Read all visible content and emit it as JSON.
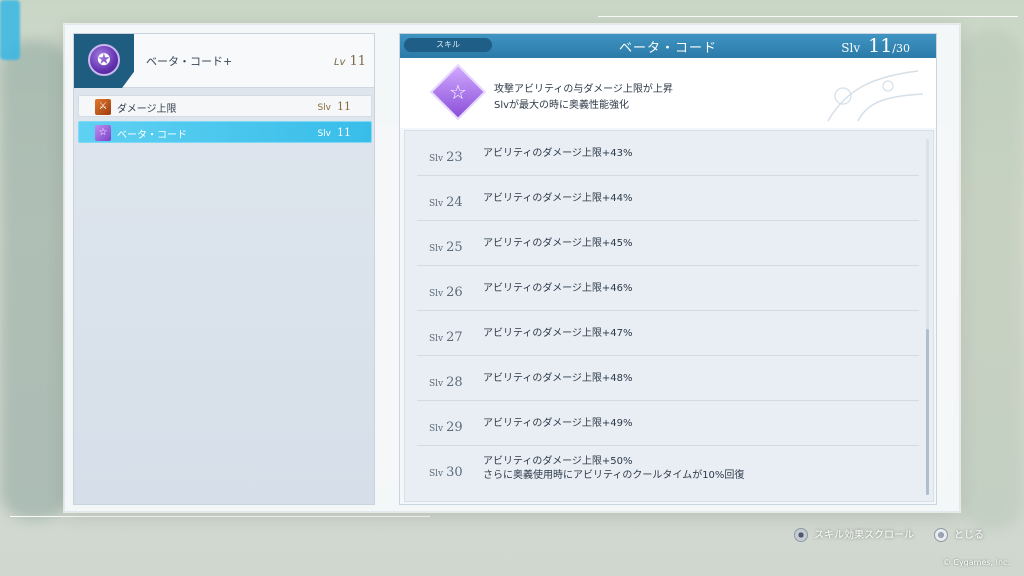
{
  "colors": {
    "accent_blue": "#38bde9",
    "header_blue": "#2b7aa8",
    "star_purple": "#8a4fd8",
    "sword_orange": "#e0782a"
  },
  "left_panel": {
    "emblem_icon": "purple-star-emblem-icon",
    "title": "ベータ・コード+",
    "lv_label": "Lv",
    "lv_value": "11",
    "skills": [
      {
        "icon": "sword-icon",
        "name": "ダメージ上限",
        "slv_label": "Slv",
        "slv_value": "11",
        "selected": false
      },
      {
        "icon": "star-icon",
        "name": "ベータ・コード",
        "slv_label": "Slv",
        "slv_value": "11",
        "selected": true
      }
    ]
  },
  "right_panel": {
    "tag": "スキル",
    "title": "ベータ・コード",
    "slv_label": "Slv",
    "slv_current": "11",
    "slv_max": "/30",
    "description": [
      "攻撃アビリティの与ダメージ上限が上昇",
      "Slvが最大の時に奥義性能強化"
    ],
    "levels": [
      {
        "label": "Slv",
        "num": "23",
        "effect": [
          "アビリティのダメージ上限+43%"
        ]
      },
      {
        "label": "Slv",
        "num": "24",
        "effect": [
          "アビリティのダメージ上限+44%"
        ]
      },
      {
        "label": "Slv",
        "num": "25",
        "effect": [
          "アビリティのダメージ上限+45%"
        ]
      },
      {
        "label": "Slv",
        "num": "26",
        "effect": [
          "アビリティのダメージ上限+46%"
        ]
      },
      {
        "label": "Slv",
        "num": "27",
        "effect": [
          "アビリティのダメージ上限+47%"
        ]
      },
      {
        "label": "Slv",
        "num": "28",
        "effect": [
          "アビリティのダメージ上限+48%"
        ]
      },
      {
        "label": "Slv",
        "num": "29",
        "effect": [
          "アビリティのダメージ上限+49%"
        ]
      },
      {
        "label": "Slv",
        "num": "30",
        "effect": [
          "アビリティのダメージ上限+50%",
          "さらに奥義使用時にアビリティのクールタイムが10%回復"
        ]
      }
    ]
  },
  "footer": {
    "scroll_hint": "スキル効果スクロール",
    "close_hint": "とじる",
    "copyright": "© Cygames, Inc."
  }
}
